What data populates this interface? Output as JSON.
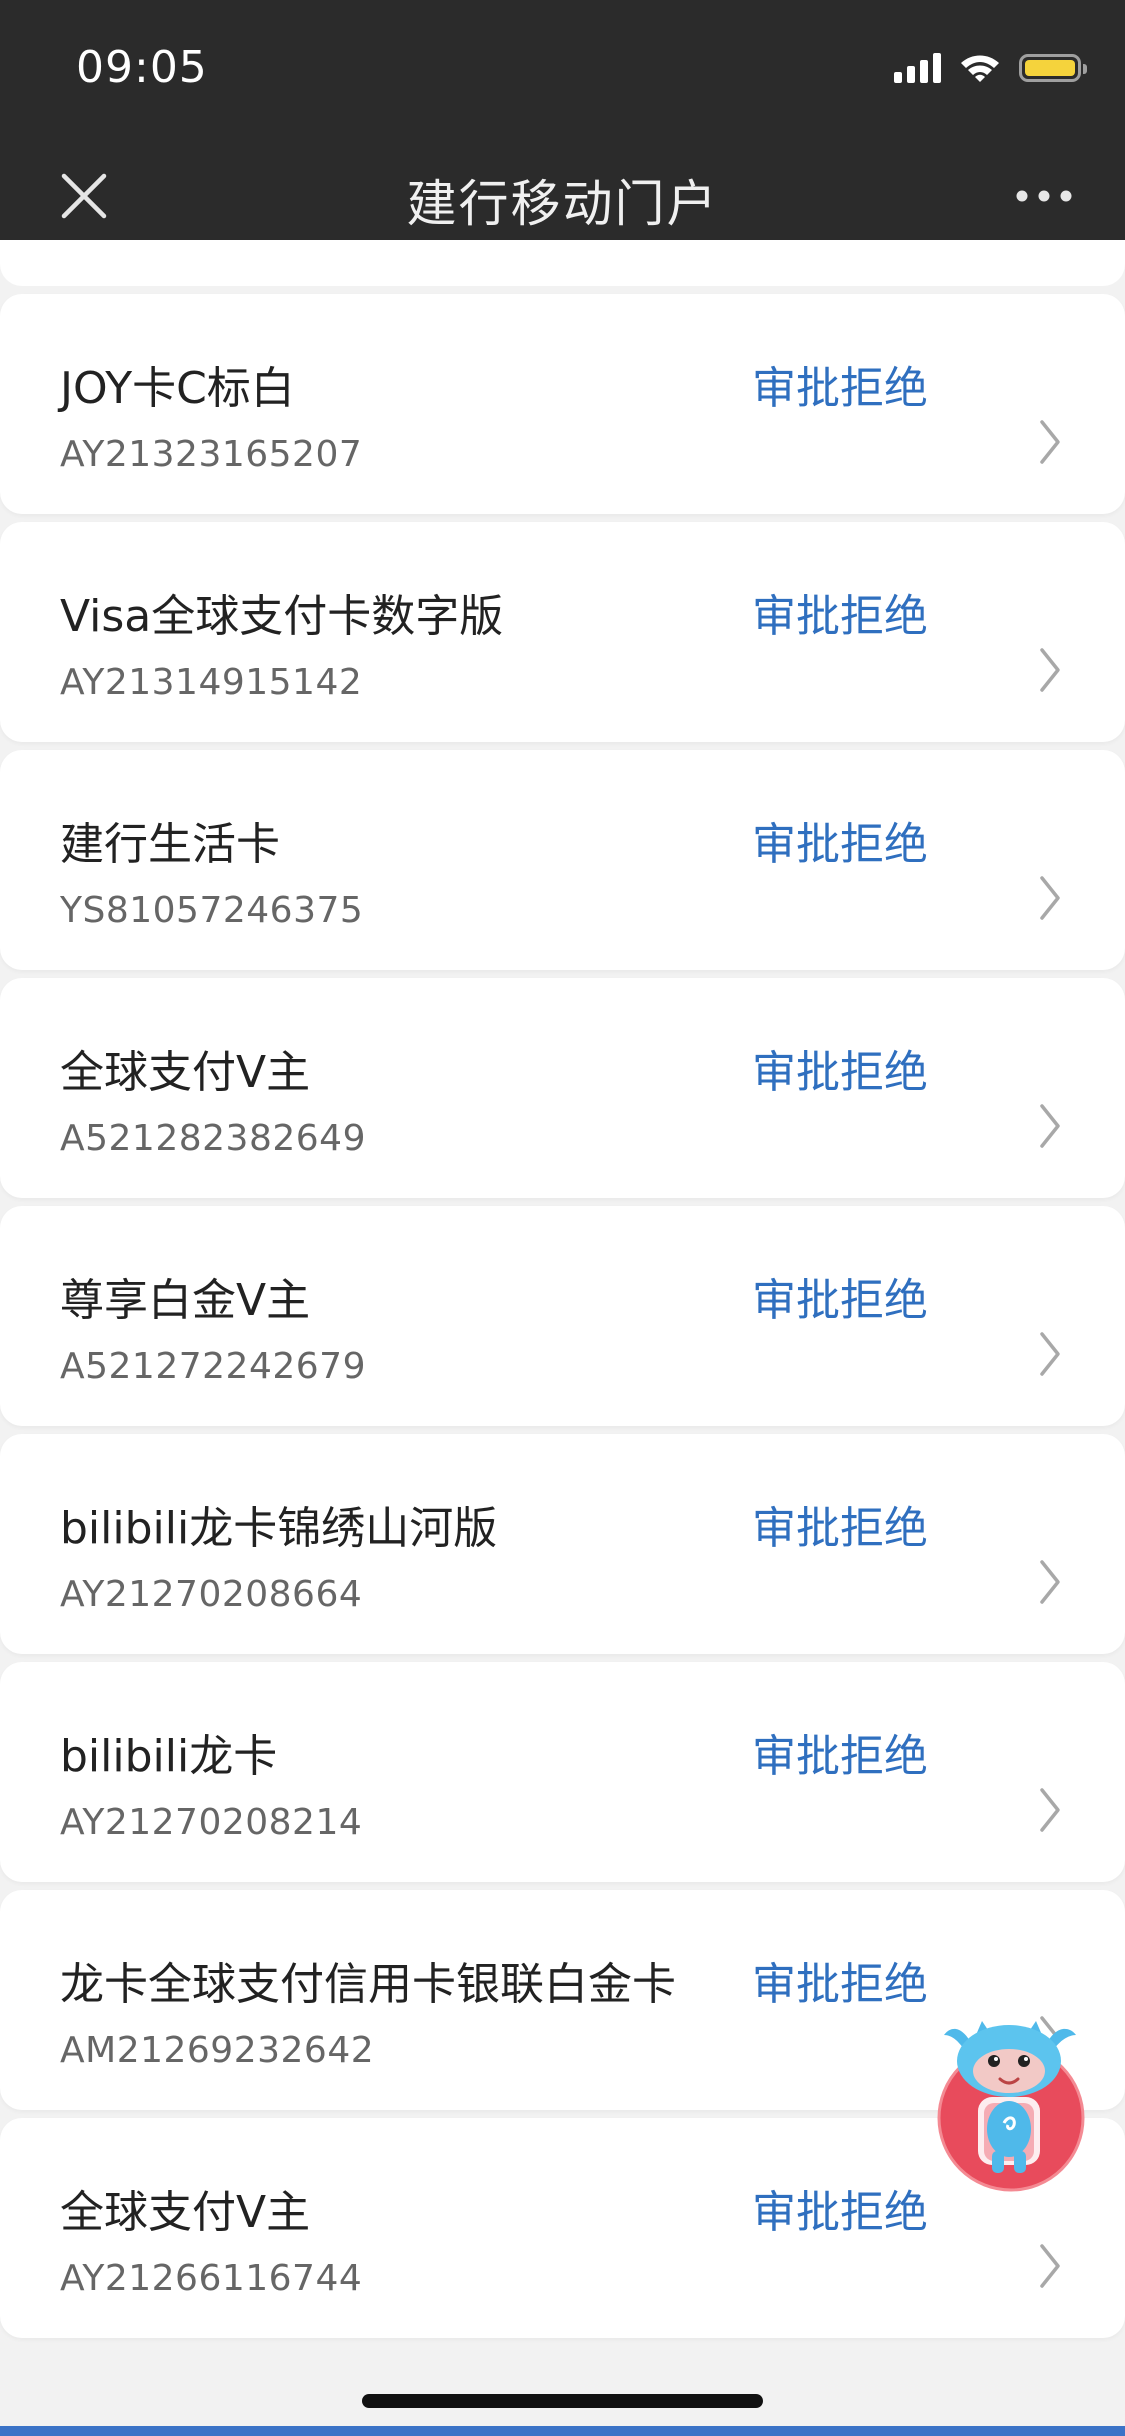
{
  "status_bar": {
    "time": "09:05",
    "battery_color": "#f5d33c"
  },
  "nav": {
    "title": "建行移动门户",
    "close_icon": "close-icon",
    "more_icon": "more-icon"
  },
  "colors": {
    "status_text": "#2f6fbf",
    "topbar_bg": "#2b2b2b",
    "page_bg": "#f2f2f2",
    "bottom_bar": "#3b73c7"
  },
  "applications": [
    {
      "name": "JOY卡C标白",
      "number": "AY21323165207",
      "status": "审批拒绝"
    },
    {
      "name": "Visa全球支付卡数字版",
      "number": "AY21314915142",
      "status": "审批拒绝"
    },
    {
      "name": "建行生活卡",
      "number": "YS81057246375",
      "status": "审批拒绝"
    },
    {
      "name": "全球支付V主",
      "number": "A521282382649",
      "status": "审批拒绝"
    },
    {
      "name": "尊享白金V主",
      "number": "A521272242679",
      "status": "审批拒绝"
    },
    {
      "name": "bilibili龙卡锦绣山河版",
      "number": "AY21270208664",
      "status": "审批拒绝"
    },
    {
      "name": "bilibili龙卡",
      "number": "AY21270208214",
      "status": "审批拒绝"
    },
    {
      "name": "龙卡全球支付信用卡银联白金卡",
      "number": "AM21269232642",
      "status": "审批拒绝"
    },
    {
      "name": "全球支付V主",
      "number": "AY21266116744",
      "status": "审批拒绝"
    }
  ]
}
